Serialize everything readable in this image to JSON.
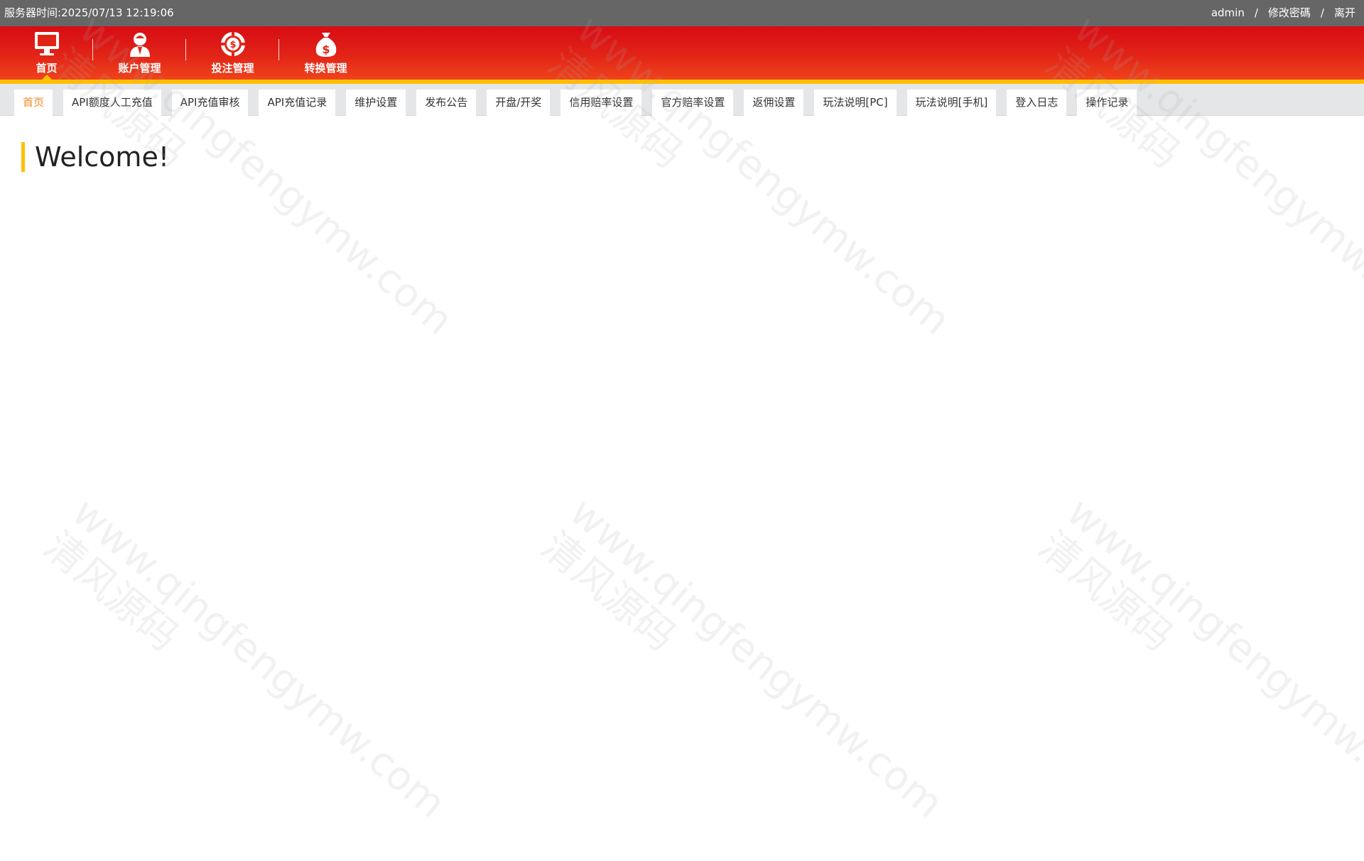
{
  "topbar": {
    "server_time_label": "服务器时间:",
    "server_time_value": "2025/07/13 12:19:06",
    "username": "admin",
    "separator": "/",
    "change_password": "修改密碼",
    "logout": "离开"
  },
  "main_nav": [
    {
      "label": "首页",
      "icon": "monitor-icon",
      "active": true
    },
    {
      "label": "账户管理",
      "icon": "user-icon",
      "active": false
    },
    {
      "label": "投注管理",
      "icon": "chip-icon",
      "active": false
    },
    {
      "label": "转换管理",
      "icon": "money-bag-icon",
      "active": false
    }
  ],
  "tabs": [
    {
      "label": "首页",
      "active": true
    },
    {
      "label": "API额度人工充值"
    },
    {
      "label": "API充值审核"
    },
    {
      "label": "API充值记录"
    },
    {
      "label": "维护设置"
    },
    {
      "label": "发布公告"
    },
    {
      "label": "开盘/开奖"
    },
    {
      "label": "信用赔率设置"
    },
    {
      "label": "官方赔率设置"
    },
    {
      "label": "返佣设置"
    },
    {
      "label": "玩法说明[PC]"
    },
    {
      "label": "玩法说明[手机]"
    },
    {
      "label": "登入日志"
    },
    {
      "label": "操作记录"
    }
  ],
  "content": {
    "welcome": "Welcome!"
  },
  "watermark": {
    "domain": "www.qingfengymw.com",
    "brand": "清风源码"
  },
  "colors": {
    "topbar_bg": "#666666",
    "header_red": "#e22417",
    "accent_yellow": "#ffc000",
    "tab_active": "#f08a24"
  }
}
